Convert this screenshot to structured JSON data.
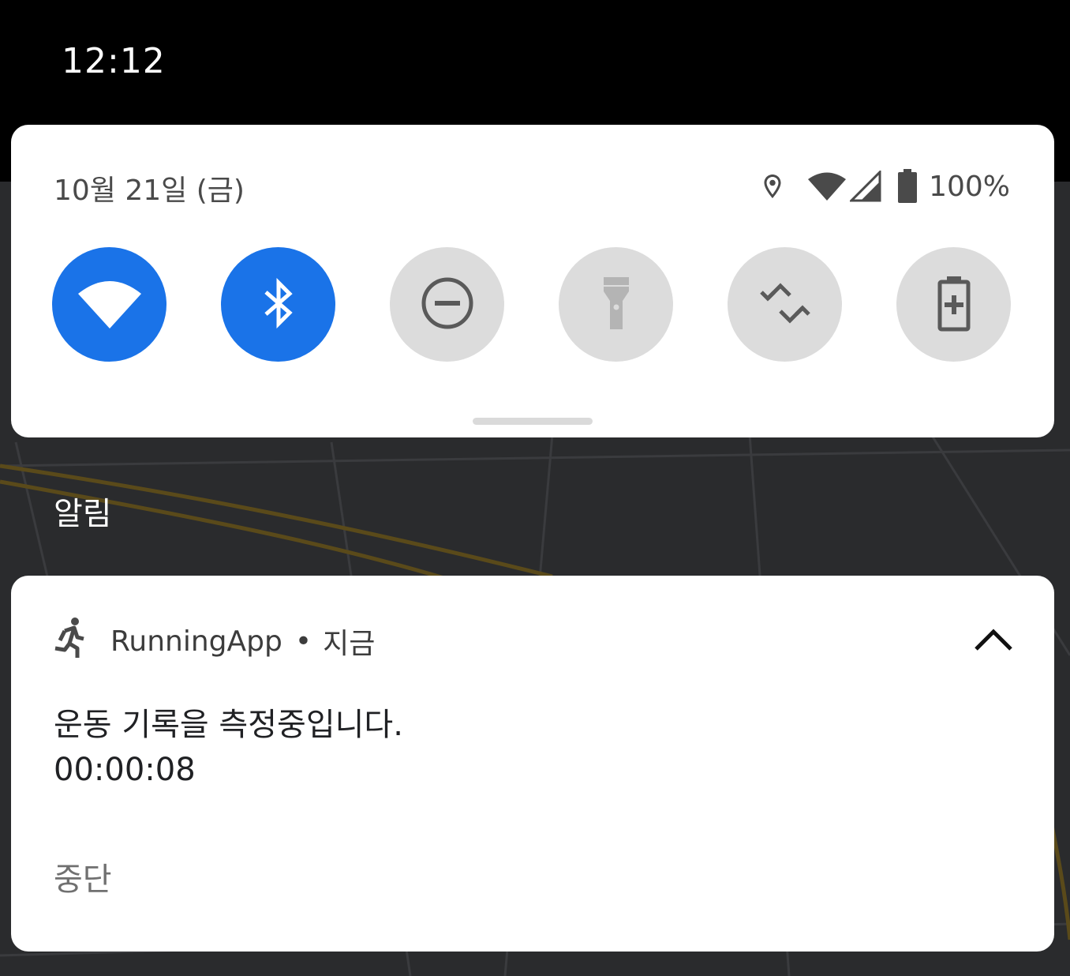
{
  "status_bar": {
    "time": "12:12"
  },
  "quick_settings": {
    "date": "10월 21일 (금)",
    "battery_percent": "100%",
    "status_icons": [
      "location-icon",
      "wifi-signal-icon",
      "cell-signal-icon",
      "battery-icon"
    ],
    "tiles": [
      {
        "icon": "wifi-icon",
        "state": "on"
      },
      {
        "icon": "bluetooth-icon",
        "state": "on"
      },
      {
        "icon": "do-not-disturb-icon",
        "state": "off"
      },
      {
        "icon": "flashlight-icon",
        "state": "off"
      },
      {
        "icon": "auto-rotate-icon",
        "state": "off"
      },
      {
        "icon": "battery-saver-icon",
        "state": "off"
      }
    ],
    "accent_color": "#1a73e8",
    "inactive_color": "#dcdcdc"
  },
  "notifications": {
    "section_title": "알림",
    "items": [
      {
        "app_icon": "running-person-icon",
        "app_name": "RunningApp",
        "separator": "•",
        "time": "지금",
        "title": "운동 기록을 측정중입니다.",
        "body": "00:00:08",
        "action": "중단",
        "expanded": true
      }
    ]
  }
}
